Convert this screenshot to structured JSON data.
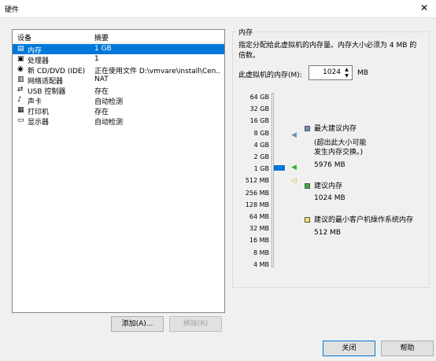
{
  "window": {
    "title": "硬件",
    "close_glyph": "✕"
  },
  "devices": {
    "headers": {
      "device": "设备",
      "summary": "摘要"
    },
    "items": [
      {
        "name": "内存",
        "summary": "1 GB",
        "icon": "memory-icon",
        "selected": true
      },
      {
        "name": "处理器",
        "summary": "1",
        "icon": "processor-icon"
      },
      {
        "name": "新 CD/DVD (IDE)",
        "summary": "正在使用文件 D:\\vmvare\\install\\Cen...",
        "icon": "cd-dvd-icon"
      },
      {
        "name": "网络适配器",
        "summary": "NAT",
        "icon": "network-icon"
      },
      {
        "name": "USB 控制器",
        "summary": "存在",
        "icon": "usb-icon"
      },
      {
        "name": "声卡",
        "summary": "自动检测",
        "icon": "sound-icon"
      },
      {
        "name": "打印机",
        "summary": "存在",
        "icon": "printer-icon"
      },
      {
        "name": "显示器",
        "summary": "自动检测",
        "icon": "display-icon"
      }
    ],
    "add_label": "添加(A)...",
    "remove_label": "移除(R)"
  },
  "memory": {
    "group_title": "内存",
    "description": "指定分配给此虚拟机的内存量。内存大小必须为 4 MB 的倍数。",
    "label": "此虚拟机的内存(M):",
    "value": "1024",
    "unit": "MB",
    "scale_ticks": [
      "64 GB",
      "32 GB",
      "16 GB",
      "8 GB",
      "4 GB",
      "2 GB",
      "1 GB",
      "512 MB",
      "256 MB",
      "128 MB",
      "64 MB",
      "32 MB",
      "16 MB",
      "8 MB",
      "4 MB"
    ],
    "legend": {
      "max": {
        "title": "最大建议内存",
        "note": "(超出此大小可能\n发生内存交换。)",
        "value": "5976 MB",
        "color": "#6f8fbf"
      },
      "recommended": {
        "title": "建议内存",
        "value": "1024 MB",
        "color": "#33b233"
      },
      "min": {
        "title": "建议的最小客户机操作系统内存",
        "value": "512 MB",
        "color": "#f2e65c"
      }
    }
  },
  "footer": {
    "close_label": "关闭",
    "help_label": "帮助"
  }
}
